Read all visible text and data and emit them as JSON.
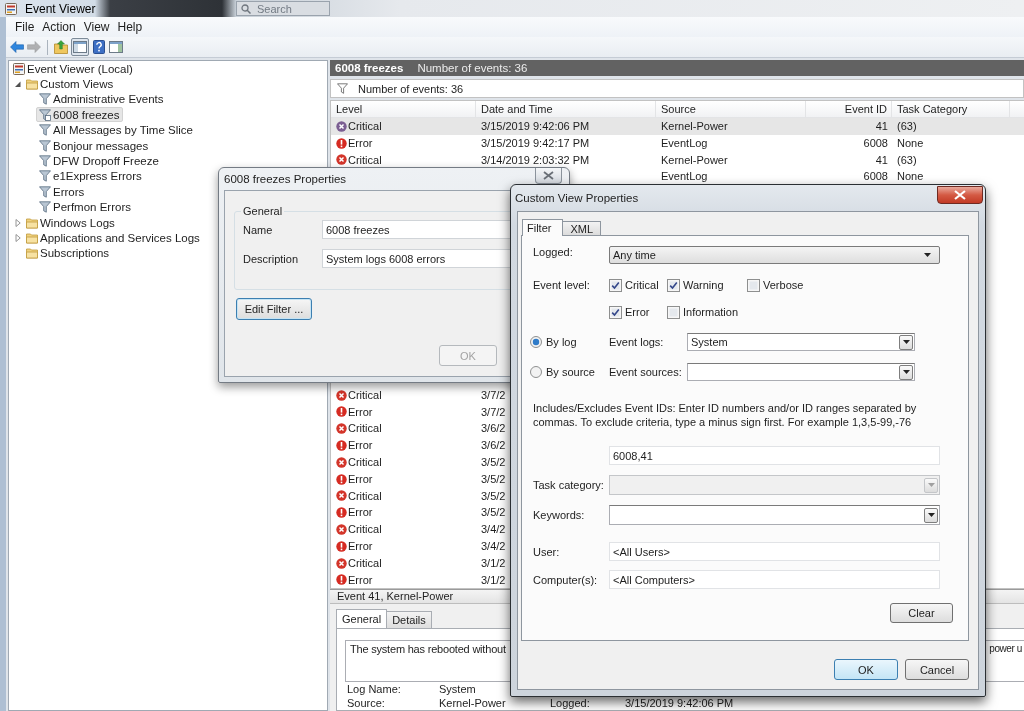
{
  "window": {
    "title": "Event Viewer",
    "search": {
      "placeholder": "Search"
    }
  },
  "menu": [
    "File",
    "Action",
    "View",
    "Help"
  ],
  "toolbar": [
    {
      "kind": "back",
      "disabled": false,
      "pressed": false
    },
    {
      "kind": "forward",
      "disabled": true,
      "pressed": false
    },
    {
      "kind": "up",
      "disabled": false,
      "pressed": false
    },
    {
      "kind": "console-tree",
      "disabled": false,
      "pressed": true
    },
    {
      "kind": "help",
      "disabled": false,
      "pressed": false
    },
    {
      "kind": "action-pane",
      "disabled": false,
      "pressed": false
    }
  ],
  "tree": [
    {
      "label": "Event Viewer (Local)",
      "kind": "root",
      "selected": false,
      "children": [
        {
          "label": "Custom Views",
          "kind": "folder",
          "expanded": true,
          "selected": false,
          "children": [
            {
              "label": "Administrative Events",
              "kind": "view",
              "selected": false
            },
            {
              "label": "6008 freezes",
              "kind": "view",
              "selected": true
            },
            {
              "label": "All Messages by Time Slice",
              "kind": "view",
              "selected": false
            },
            {
              "label": "Bonjour messages",
              "kind": "view",
              "selected": false
            },
            {
              "label": "DFW Dropoff Freeze",
              "kind": "view",
              "selected": false
            },
            {
              "label": "e1Express Errors",
              "kind": "view",
              "selected": false
            },
            {
              "label": "Errors",
              "kind": "view",
              "selected": false
            },
            {
              "label": "Perfmon Errors",
              "kind": "view",
              "selected": false
            }
          ]
        },
        {
          "label": "Windows Logs",
          "kind": "folder",
          "expanded": false,
          "selected": false
        },
        {
          "label": "Applications and Services Logs",
          "kind": "folder",
          "expanded": false,
          "selected": false
        },
        {
          "label": "Subscriptions",
          "kind": "folder",
          "selected": false
        }
      ]
    }
  ],
  "view": {
    "title": "6008 freezes",
    "count": "Number of events: 36",
    "filter_summary": "Number of events: 36"
  },
  "table": {
    "columns": [
      "Level",
      "Date and Time",
      "Source",
      "Event ID",
      "Task Category"
    ],
    "rows": [
      {
        "kind": "critical",
        "level": "Critical",
        "date": "3/15/2019 9:42:06 PM",
        "source": "Kernel-Power",
        "event_id": "41",
        "task_category": "(63)",
        "selected": true
      },
      {
        "kind": "error",
        "level": "Error",
        "date": "3/15/2019 9:42:17 PM",
        "source": "EventLog",
        "event_id": "6008",
        "task_category": "None",
        "selected": false
      },
      {
        "kind": "critical",
        "level": "Critical",
        "date": "3/14/2019 2:03:32 PM",
        "source": "Kernel-Power",
        "event_id": "41",
        "task_category": "(63)",
        "selected": false
      },
      {
        "source": "EventLog",
        "event_id": "6008",
        "task_category": "None",
        "selected": false
      }
    ],
    "lower_rows": [
      {
        "kind": "critical",
        "level": "Critical",
        "date": "3/7/2",
        "selected": false
      },
      {
        "kind": "error",
        "level": "Error",
        "date": "3/7/2",
        "selected": false
      },
      {
        "kind": "critical",
        "level": "Critical",
        "date": "3/6/2",
        "selected": false
      },
      {
        "kind": "error",
        "level": "Error",
        "date": "3/6/2",
        "selected": false
      },
      {
        "kind": "critical",
        "level": "Critical",
        "date": "3/5/2",
        "selected": false
      },
      {
        "kind": "error",
        "level": "Error",
        "date": "3/5/2",
        "selected": false
      },
      {
        "kind": "critical",
        "level": "Critical",
        "date": "3/5/2",
        "selected": false
      },
      {
        "kind": "error",
        "level": "Error",
        "date": "3/5/2",
        "selected": false
      },
      {
        "kind": "critical",
        "level": "Critical",
        "date": "3/4/2",
        "selected": false
      },
      {
        "kind": "error",
        "level": "Error",
        "date": "3/4/2",
        "selected": false
      },
      {
        "kind": "critical",
        "level": "Critical",
        "date": "3/1/2",
        "selected": false
      },
      {
        "kind": "error",
        "level": "Error",
        "date": "3/1/2",
        "selected": false
      }
    ]
  },
  "details": {
    "header": "Event 41, Kernel-Power",
    "tabs": [
      {
        "label": "General",
        "selected": true
      },
      {
        "label": "Details",
        "selected": false
      }
    ],
    "message": [
      "The system has rebooted without",
      "power u"
    ],
    "rows": [
      {
        "items": [
          {
            "label": "Log Name:",
            "value": "System"
          }
        ]
      },
      {
        "items": [
          {
            "label": "Source:",
            "value": "Kernel-Power"
          },
          {
            "label": "Logged:",
            "value": "3/15/2019 9:42:06 PM"
          }
        ]
      }
    ]
  },
  "properties_dialog": {
    "title": "6008 freezes Properties",
    "group_title": "General",
    "fields": [
      {
        "label": "Name",
        "value": "6008 freezes"
      },
      {
        "label": "Description",
        "value": "System logs 6008 errors"
      }
    ],
    "edit_filter_button": "Edit Filter ...",
    "ok_button": {
      "label": "OK",
      "disabled": true
    }
  },
  "custom_view_dialog": {
    "title": "Custom View Properties",
    "tabs": [
      {
        "label": "Filter",
        "selected": true
      },
      {
        "label": "XML",
        "selected": false
      }
    ],
    "logged": {
      "label": "Logged:",
      "value": "Any time"
    },
    "event_level": {
      "label": "Event level:",
      "options": [
        {
          "label": "Critical",
          "checked": true
        },
        {
          "label": "Warning",
          "checked": true
        },
        {
          "label": "Verbose",
          "checked": false
        },
        {
          "label": "Error",
          "checked": true
        },
        {
          "label": "Information",
          "checked": false
        }
      ]
    },
    "log_sources": [
      {
        "label": "By log",
        "selected": true,
        "field_label": "Event logs:",
        "value": "System"
      },
      {
        "label": "By source",
        "selected": false,
        "field_label": "Event sources:"
      }
    ],
    "event_ids_hint": "Includes/Excludes Event IDs: Enter ID numbers and/or ID ranges separated by commas. To exclude criteria, type a minus sign first. For example 1,3,5-99,-76",
    "event_ids": "6008,41",
    "combos": [
      {
        "label": "Task category:",
        "disabled": true
      },
      {
        "label": "Keywords:",
        "disabled": false
      }
    ],
    "text_fields": [
      {
        "label": "User:",
        "value": "<All Users>"
      },
      {
        "label": "Computer(s):",
        "value": "<All Computers>"
      }
    ],
    "clear_button": "Clear",
    "buttons": [
      {
        "label": "OK",
        "default": true
      },
      {
        "label": "Cancel",
        "default": false
      }
    ]
  }
}
